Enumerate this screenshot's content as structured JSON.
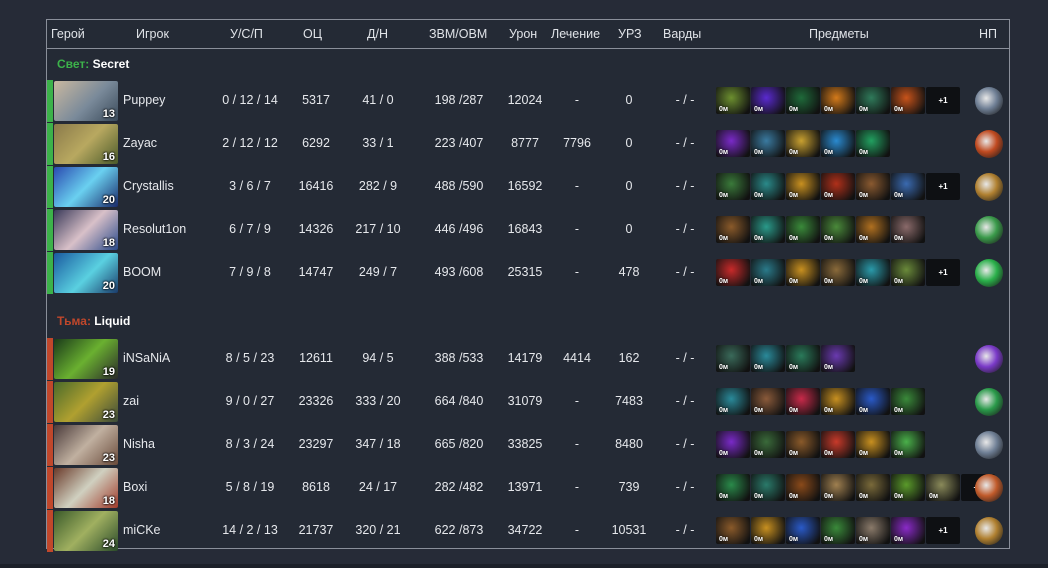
{
  "headers": {
    "hero": "Герой",
    "player": "Игрок",
    "kda": "У/С/П",
    "nw": "ОЦ",
    "lhdn": "Д/Н",
    "gpmxpm": "ЗВМ/ОВМ",
    "damage": "Урон",
    "healing": "Лечение",
    "towerdmg": "УРЗ",
    "wards": "Варды",
    "items": "Предметы",
    "np": "НП"
  },
  "colors": {
    "radiant": "#3cb24a",
    "dire": "#c0472b"
  },
  "teams": [
    {
      "side": "Свет:",
      "name": "Secret",
      "players": [
        {
          "hero_icon": "tusk",
          "level": "13",
          "player": "Puppey",
          "kda": "0 / 12 / 14",
          "nw": "5317",
          "lhdn": "41 / 0",
          "gpmxpm": "198 /287",
          "damage": "12024",
          "healing": "-",
          "towerdmg": "0",
          "wards": "- / -",
          "items": [
            {
              "c": "#6c8f2f",
              "cd": "0м"
            },
            {
              "c": "#5a2ad0",
              "cd": "0м"
            },
            {
              "c": "#1f6a3a",
              "cd": "0м"
            },
            {
              "c": "#d47a1a",
              "cd": "0м"
            },
            {
              "c": "#2f7a5a",
              "cd": "0м"
            },
            {
              "c": "#c8531a",
              "cd": "0м"
            }
          ],
          "extra": "+1",
          "np_icon": "#6f7f95"
        },
        {
          "hero_icon": "treant",
          "level": "16",
          "player": "Zayac",
          "kda": "2 / 12 / 12",
          "nw": "6292",
          "lhdn": "33 / 1",
          "gpmxpm": "223 /407",
          "damage": "8777",
          "healing": "7796",
          "towerdmg": "0",
          "wards": "- / -",
          "items": [
            {
              "c": "#7a2ac8",
              "cd": "0м"
            },
            {
              "c": "#3a7aa0",
              "cd": "0м"
            },
            {
              "c": "#c8a030",
              "cd": "0м"
            },
            {
              "c": "#2a8ad0",
              "cd": "0м"
            },
            {
              "c": "#22a060",
              "cd": "0м"
            }
          ],
          "extra": "",
          "np_icon": "#c04a20"
        },
        {
          "hero_icon": "razor",
          "level": "20",
          "player": "Crystallis",
          "kda": "3 / 6 / 7",
          "nw": "16416",
          "lhdn": "282 / 9",
          "gpmxpm": "488 /590",
          "damage": "16592",
          "healing": "-",
          "towerdmg": "0",
          "wards": "- / -",
          "items": [
            {
              "c": "#3a7a3a",
              "cd": "0м"
            },
            {
              "c": "#2a8a8a",
              "cd": "0м"
            },
            {
              "c": "#c89020",
              "cd": "0м"
            },
            {
              "c": "#b0301a",
              "cd": "0м"
            },
            {
              "c": "#8a5a30",
              "cd": "0м"
            },
            {
              "c": "#3a6ab0",
              "cd": "0м"
            }
          ],
          "extra": "+1",
          "np_icon": "#b08030"
        },
        {
          "hero_icon": "templar",
          "level": "18",
          "player": "Resolut1on",
          "kda": "6 / 7 / 9",
          "nw": "14326",
          "lhdn": "217 / 10",
          "gpmxpm": "446 /496",
          "damage": "16843",
          "healing": "-",
          "towerdmg": "0",
          "wards": "- / -",
          "items": [
            {
              "c": "#8a5a2a",
              "cd": "0м"
            },
            {
              "c": "#2a9a8a",
              "cd": "0м"
            },
            {
              "c": "#3a8a3a",
              "cd": "0м"
            },
            {
              "c": "#4a8a3a",
              "cd": "0м"
            },
            {
              "c": "#b07020",
              "cd": "0м"
            },
            {
              "c": "#8a6a6a",
              "cd": "0м"
            }
          ],
          "extra": "",
          "np_icon": "#3a9a4a"
        },
        {
          "hero_icon": "morph",
          "level": "20",
          "player": "BOOM",
          "kda": "7 / 9 / 8",
          "nw": "14747",
          "lhdn": "249 / 7",
          "gpmxpm": "493 /608",
          "damage": "25315",
          "healing": "-",
          "towerdmg": "478",
          "wards": "- / -",
          "items": [
            {
              "c": "#c82a2a",
              "cd": "0м"
            },
            {
              "c": "#2a7a8a",
              "cd": "0м"
            },
            {
              "c": "#c89020",
              "cd": "0м"
            },
            {
              "c": "#8a6a3a",
              "cd": "0м"
            },
            {
              "c": "#2a9aaa",
              "cd": "0м"
            },
            {
              "c": "#6a8a3a",
              "cd": "0м"
            }
          ],
          "extra": "+1",
          "np_icon": "#2ab04a"
        }
      ]
    },
    {
      "side": "Тьма:",
      "name": "Liquid",
      "players": [
        {
          "hero_icon": "rubick",
          "level": "19",
          "player": "iNSaNiA",
          "kda": "8 / 5 / 23",
          "nw": "12611",
          "lhdn": "94 / 5",
          "gpmxpm": "388 /533",
          "damage": "14179",
          "healing": "4414",
          "towerdmg": "162",
          "wards": "- / -",
          "items": [
            {
              "c": "#3a6a5a",
              "cd": "0м"
            },
            {
              "c": "#2a8a9a",
              "cd": "0м"
            },
            {
              "c": "#2a7a5a",
              "cd": "0м"
            },
            {
              "c": "#6a3ab0",
              "cd": "0м"
            }
          ],
          "extra": "",
          "np_icon": "#7a3ac8"
        },
        {
          "hero_icon": "tinker",
          "level": "23",
          "player": "zai",
          "kda": "9 / 0 / 27",
          "nw": "23326",
          "lhdn": "333 / 20",
          "gpmxpm": "664 /840",
          "damage": "31079",
          "healing": "-",
          "towerdmg": "7483",
          "wards": "- / -",
          "items": [
            {
              "c": "#2a8a9a",
              "cd": "0м"
            },
            {
              "c": "#8a5a3a",
              "cd": "0м"
            },
            {
              "c": "#c82a4a",
              "cd": "0м"
            },
            {
              "c": "#c89020",
              "cd": "0м"
            },
            {
              "c": "#2a5ac8",
              "cd": "0м"
            },
            {
              "c": "#3a8a3a",
              "cd": "0м"
            }
          ],
          "extra": "",
          "np_icon": "#2a9a4a"
        },
        {
          "hero_icon": "sniper",
          "level": "23",
          "player": "Nisha",
          "kda": "8 / 3 / 24",
          "nw": "23297",
          "lhdn": "347 / 18",
          "gpmxpm": "665 /820",
          "damage": "33825",
          "healing": "-",
          "towerdmg": "8480",
          "wards": "- / -",
          "items": [
            {
              "c": "#7a2ac8",
              "cd": "0м"
            },
            {
              "c": "#3a6a3a",
              "cd": "0м"
            },
            {
              "c": "#8a5a2a",
              "cd": "0м"
            },
            {
              "c": "#c83a2a",
              "cd": "0м"
            },
            {
              "c": "#c89020",
              "cd": "0м"
            },
            {
              "c": "#4ab04a",
              "cd": "0м"
            }
          ],
          "extra": "",
          "np_icon": "#6f7f95"
        },
        {
          "hero_icon": "chaos",
          "level": "18",
          "player": "Boxi",
          "kda": "5 / 8 / 19",
          "nw": "8618",
          "lhdn": "24 / 17",
          "gpmxpm": "282 /482",
          "damage": "13971",
          "healing": "-",
          "towerdmg": "739",
          "wards": "- / -",
          "items": [
            {
              "c": "#2a8a4a",
              "cd": "0м"
            },
            {
              "c": "#2a7a6a",
              "cd": "0м"
            },
            {
              "c": "#8a4a1a",
              "cd": "0м"
            },
            {
              "c": "#a08050",
              "cd": "0м"
            },
            {
              "c": "#7a6a3a",
              "cd": "0м"
            },
            {
              "c": "#5a9a2a",
              "cd": "0м"
            },
            {
              "c": "#8a8a5a",
              "cd": "0м"
            }
          ],
          "extra": "+3",
          "np_icon": "#c05a2a"
        },
        {
          "hero_icon": "tidehunter",
          "level": "24",
          "player": "miCKe",
          "kda": "14 / 2 / 13",
          "nw": "21737",
          "lhdn": "320 / 21",
          "gpmxpm": "622 /873",
          "damage": "34722",
          "healing": "-",
          "towerdmg": "10531",
          "wards": "- / -",
          "items": [
            {
              "c": "#8a5a2a",
              "cd": "0м"
            },
            {
              "c": "#c89020",
              "cd": "0м"
            },
            {
              "c": "#2a5ac8",
              "cd": "0м"
            },
            {
              "c": "#3a8a3a",
              "cd": "0м"
            },
            {
              "c": "#8a7a6a",
              "cd": "0м"
            },
            {
              "c": "#8a2ac8",
              "cd": "0м"
            }
          ],
          "extra": "+1",
          "np_icon": "#b08030"
        }
      ]
    }
  ]
}
